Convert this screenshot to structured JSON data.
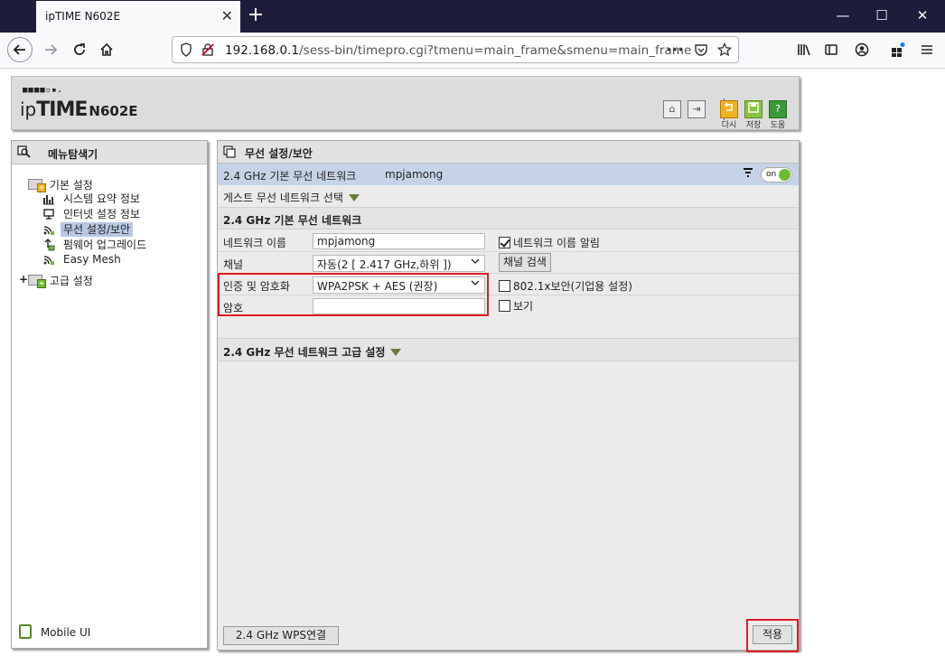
{
  "browser": {
    "tab_title": "ipTIME N602E",
    "tab_close": "✕",
    "new_tab": "+",
    "url_host": "192.168.0.1",
    "url_path": "/sess-bin/timepro.cgi?tmenu=main_frame&smenu=main_frame",
    "url_more": "•••",
    "win_min": "—",
    "win_max": "☐",
    "win_close": "✕"
  },
  "router_header": {
    "logo_dots": "■■■■▫▪.",
    "logo_ip": "ip",
    "logo_time": "TIME",
    "logo_model": "N602E",
    "btn_home": "⌂",
    "btn_logout": "⇥",
    "btn_reload_label": "다시",
    "btn_save_label": "저장",
    "btn_help_label": "도움",
    "btn_help": "?"
  },
  "sidebar": {
    "title": "메뉴탐색기",
    "group_basic": "기본 설정",
    "items": [
      {
        "label": "시스템 요약 정보"
      },
      {
        "label": "인터넷 설정 정보"
      },
      {
        "label": "무선 설정/보안"
      },
      {
        "label": "펌웨어 업그레이드"
      },
      {
        "label": "Easy Mesh"
      }
    ],
    "group_advanced": "고급 설정",
    "mobile_ui": "Mobile UI"
  },
  "content": {
    "title": "무선 설정/보안",
    "status_label": "2.4 GHz 기본 무선 네트워크",
    "status_ssid": "mpjamong",
    "toggle_text": "on",
    "guest_label": "게스트 무선 네트워크 선택",
    "section_basic": "2.4 GHz 기본 무선 네트워크",
    "network_name_label": "네트워크 이름",
    "network_name_value": "mpjamong",
    "broadcast_label": "네트워크 이름 알림",
    "channel_label": "채널",
    "channel_value": "자동(2 [ 2.417 GHz,하위 ])",
    "channel_scan": "채널 검색",
    "auth_label": "인증 및 암호화",
    "auth_value": "WPA2PSK + AES (권장)",
    "enterprise_label": "802.1x보안(기업용 설정)",
    "password_label": "암호",
    "password_value": "",
    "show_label": "보기",
    "section_advanced": "2.4 GHz 무선 네트워크 고급 설정",
    "wps_button": "2.4 GHz WPS연결",
    "apply_button": "적용"
  },
  "colors": {
    "accent_highlight": "#e01a24",
    "selected_row": "#c6d3e7",
    "toggle_on": "#6dbb2f"
  }
}
